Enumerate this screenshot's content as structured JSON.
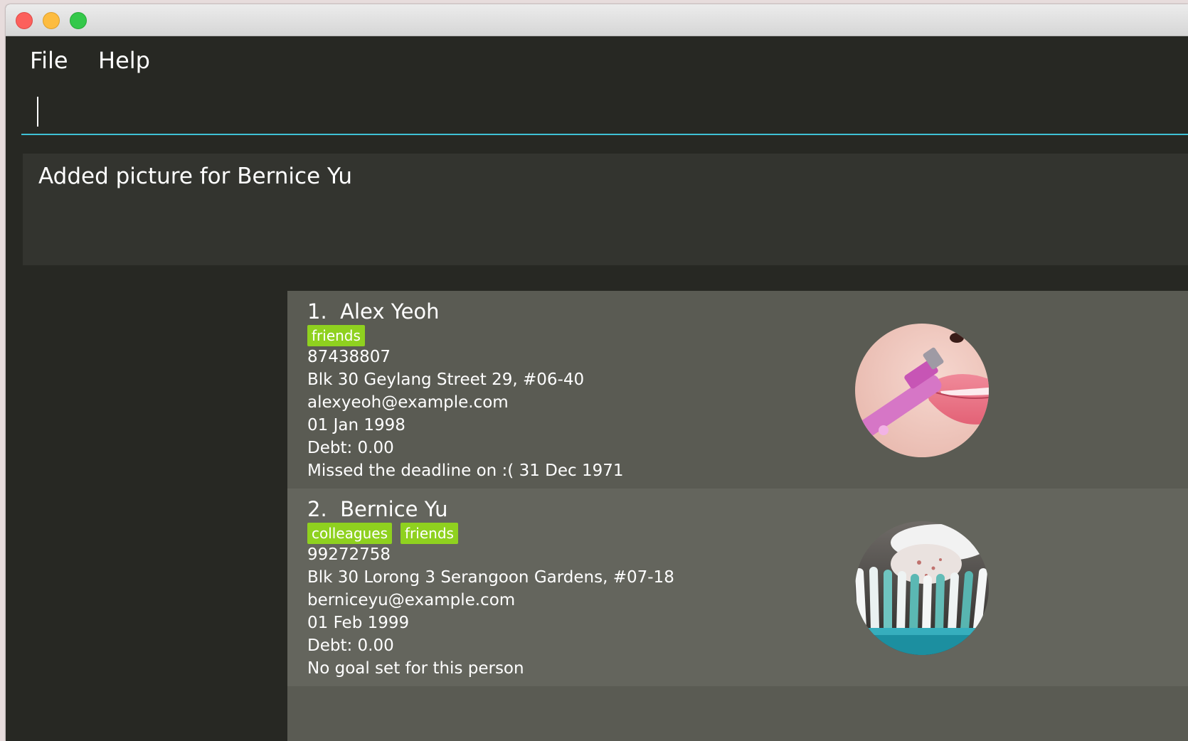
{
  "menu": {
    "file": "File",
    "help": "Help"
  },
  "command": {
    "value": ""
  },
  "result": {
    "message": "Added picture for Bernice Yu"
  },
  "persons": [
    {
      "index": "1.",
      "name": "Alex Yeoh",
      "tags": [
        "friends"
      ],
      "phone": "87438807",
      "address": "Blk 30 Geylang Street 29, #06-40",
      "email": "alexyeoh@example.com",
      "birthday": "01 Jan 1998",
      "debt": "Debt: 0.00",
      "goal": "Missed the deadline on :( 31 Dec 1971",
      "picture": "lip-trimmer-photo"
    },
    {
      "index": "2.",
      "name": "Bernice Yu",
      "tags": [
        "colleagues",
        "friends"
      ],
      "phone": "99272758",
      "address": "Blk 30 Lorong 3 Serangoon Gardens, #07-18",
      "email": "berniceyu@example.com",
      "birthday": "01 Feb 1999",
      "debt": "Debt: 0.00",
      "goal": "No goal set for this person",
      "picture": "toothbrush-photo"
    }
  ],
  "colors": {
    "window_bg": "#272823",
    "result_bg": "#33342f",
    "card_bg_odd": "#5a5b53",
    "card_bg_even": "#64655d",
    "tag_bg": "#8fd11f",
    "command_underline": "#3fc1d6"
  }
}
